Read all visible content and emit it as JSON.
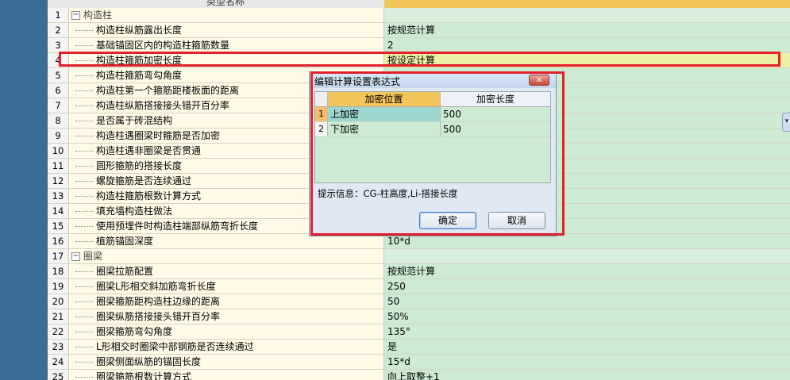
{
  "header": {
    "name_col": "类型名称",
    "value_col": ""
  },
  "rows": [
    {
      "num": "1",
      "name": "构造柱",
      "value": "",
      "group": true,
      "highlight": false
    },
    {
      "num": "2",
      "name": "构造柱纵筋露出长度",
      "value": "按规范计算",
      "group": false,
      "highlight": false
    },
    {
      "num": "3",
      "name": "基础锚固区内的构造柱箍筋数量",
      "value": "2",
      "group": false,
      "highlight": false
    },
    {
      "num": "4",
      "name": "构造柱箍筋加密长度",
      "value": "按设定计算",
      "group": false,
      "highlight": true
    },
    {
      "num": "5",
      "name": "构造柱箍筋弯勾角度",
      "value": "",
      "group": false,
      "highlight": false
    },
    {
      "num": "6",
      "name": "构造柱第一个箍筋距楼板面的距离",
      "value": "",
      "group": false,
      "highlight": false
    },
    {
      "num": "7",
      "name": "构造柱纵筋搭接接头错开百分率",
      "value": "",
      "group": false,
      "highlight": false
    },
    {
      "num": "8",
      "name": "是否属于砖混结构",
      "value": "",
      "group": false,
      "highlight": false
    },
    {
      "num": "9",
      "name": "构造柱遇圈梁时箍筋是否加密",
      "value": "",
      "group": false,
      "highlight": false
    },
    {
      "num": "10",
      "name": "构造柱遇非圈梁是否贯通",
      "value": "",
      "group": false,
      "highlight": false
    },
    {
      "num": "11",
      "name": "圆形箍筋的搭接长度",
      "value": "",
      "group": false,
      "highlight": false
    },
    {
      "num": "12",
      "name": "螺旋箍筋是否连续通过",
      "value": "",
      "group": false,
      "highlight": false
    },
    {
      "num": "13",
      "name": "构造柱箍筋根数计算方式",
      "value": "",
      "group": false,
      "highlight": false
    },
    {
      "num": "14",
      "name": "填充墙构造柱做法",
      "value": "",
      "group": false,
      "highlight": false
    },
    {
      "num": "15",
      "name": "使用预埋件时构造柱端部纵筋弯折长度",
      "value": "",
      "group": false,
      "highlight": false
    },
    {
      "num": "16",
      "name": "植筋锚固深度",
      "value": "10*d",
      "group": false,
      "highlight": false
    },
    {
      "num": "17",
      "name": "圈梁",
      "value": "",
      "group": true,
      "highlight": false
    },
    {
      "num": "18",
      "name": "圈梁拉筋配置",
      "value": "按规范计算",
      "group": false,
      "highlight": false
    },
    {
      "num": "19",
      "name": "圈梁L形相交斜加筋弯折长度",
      "value": "250",
      "group": false,
      "highlight": false
    },
    {
      "num": "20",
      "name": "圈梁箍筋距构造柱边缘的距离",
      "value": "50",
      "group": false,
      "highlight": false
    },
    {
      "num": "21",
      "name": "圈梁纵筋搭接接头错开百分率",
      "value": "50%",
      "group": false,
      "highlight": false
    },
    {
      "num": "22",
      "name": "圈梁箍筋弯勾角度",
      "value": "135°",
      "group": false,
      "highlight": false
    },
    {
      "num": "23",
      "name": "L形相交时圈梁中部钢筋是否连续通过",
      "value": "是",
      "group": false,
      "highlight": false
    },
    {
      "num": "24",
      "name": "圈梁侧面纵筋的锚固长度",
      "value": "15*d",
      "group": false,
      "highlight": false
    },
    {
      "num": "25",
      "name": "圈梁箍筋根数计算方式",
      "value": "向上取整+1",
      "group": false,
      "highlight": false
    }
  ],
  "dialog": {
    "title": "编辑计算设置表达式",
    "close_glyph": "✕",
    "col_position": "加密位置",
    "col_length": "加密长度",
    "items": [
      {
        "num": "1",
        "position": "上加密",
        "length": "500"
      },
      {
        "num": "2",
        "position": "下加密",
        "length": "500"
      }
    ],
    "hint": "提示信息：CG-柱高度,Li-搭接长度",
    "ok_label": "确定",
    "cancel_label": "取消"
  },
  "icons": {
    "collapse": "−",
    "scroll_tab": "▾"
  },
  "colors": {
    "highlight_border": "#e0202a",
    "value_bg": "#ccebd2",
    "header_accent": "#f3c55d"
  }
}
